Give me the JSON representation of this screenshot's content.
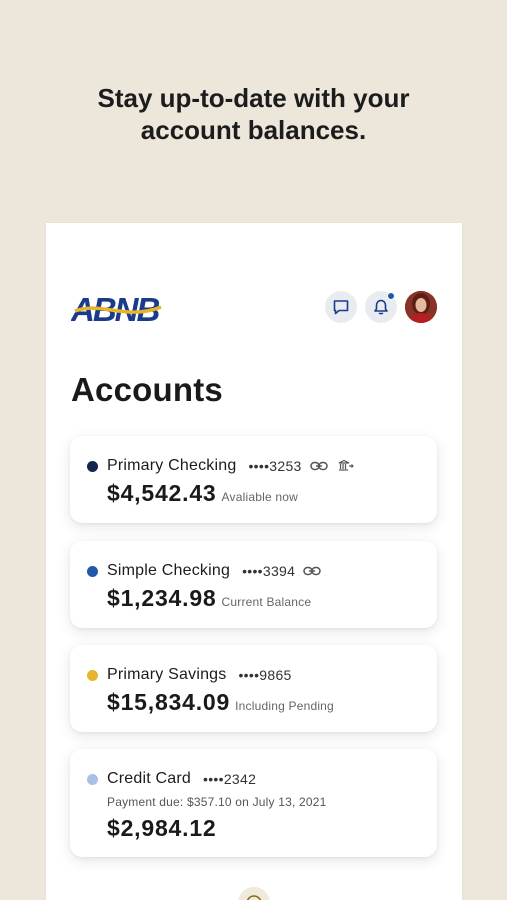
{
  "headline": {
    "line1": "Stay up-to-date with your",
    "line2": "account balances."
  },
  "brand": {
    "logo_text": "ABNB",
    "colors": {
      "navy": "#1b3a8a",
      "gold": "#e6b52a"
    }
  },
  "header": {
    "chat_icon": "chat-icon",
    "bell_icon": "bell-icon",
    "has_notification": true
  },
  "page": {
    "title": "Accounts"
  },
  "accounts": [
    {
      "name": "Primary Checking",
      "number": "••••3253",
      "balance": "$4,542.43",
      "label": "Avaliable now",
      "dot_color": "#14244a",
      "icons": [
        "link-icon",
        "bank-transfer-icon"
      ]
    },
    {
      "name": "Simple Checking",
      "number": "••••3394",
      "balance": "$1,234.98",
      "label": "Current Balance",
      "dot_color": "#1e5aa8",
      "icons": [
        "link-icon"
      ]
    },
    {
      "name": "Primary Savings",
      "number": "••••9865",
      "balance": "$15,834.09",
      "label": "Including Pending",
      "dot_color": "#e6b52a",
      "icons": []
    },
    {
      "name": "Credit Card",
      "number": "••••2342",
      "payment_due": "Payment due: $357.10 on July 13, 2021",
      "balance": "$2,984.12",
      "dot_color": "#a9c0e6",
      "icons": []
    }
  ]
}
